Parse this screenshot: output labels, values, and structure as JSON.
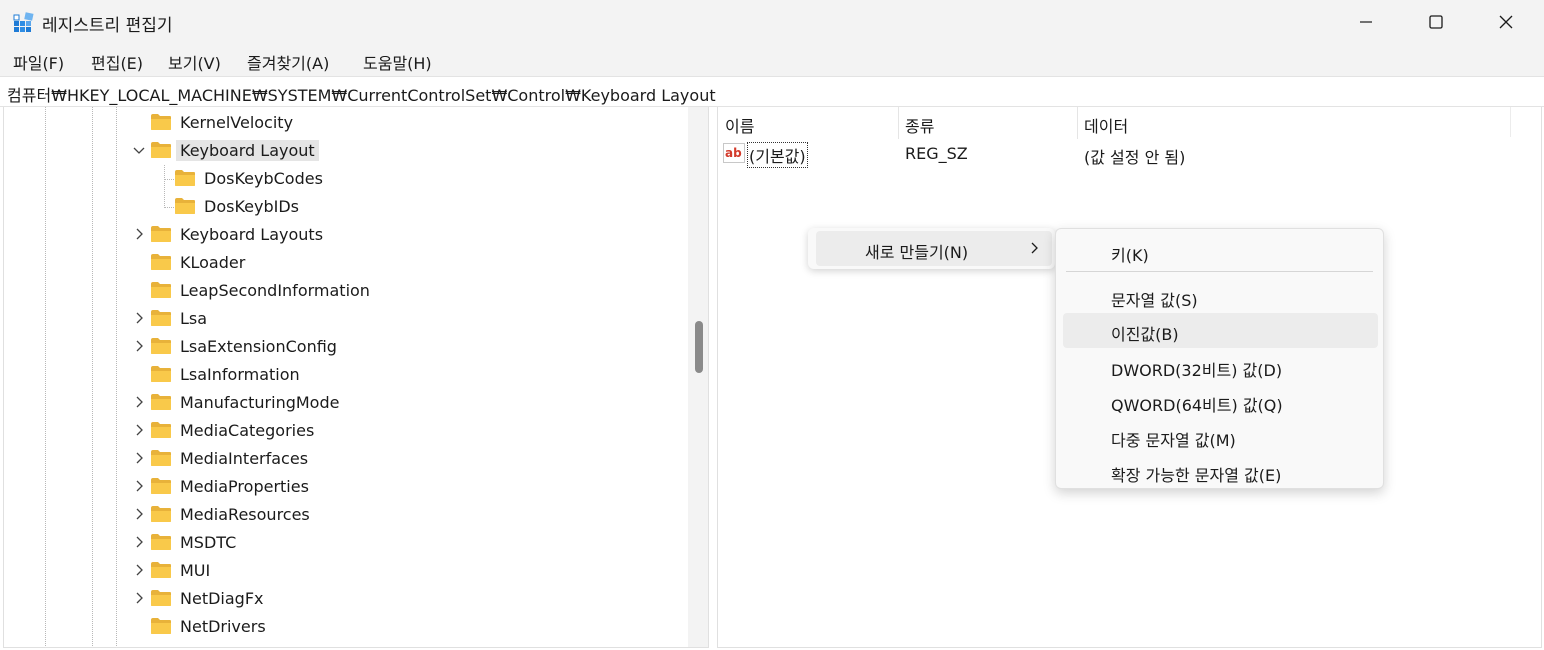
{
  "window": {
    "title": "레지스트리 편집기",
    "controls": [
      "minimize-icon",
      "maximize-icon",
      "close-icon"
    ]
  },
  "menubar": {
    "items": [
      {
        "label": "파일(F)"
      },
      {
        "label": "편집(E)"
      },
      {
        "label": "보기(V)"
      },
      {
        "label": "즐겨찾기(A)"
      },
      {
        "label": "도움말(H)"
      }
    ]
  },
  "address": {
    "path": "컴퓨터₩HKEY_LOCAL_MACHINE₩SYSTEM₩CurrentControlSet₩Control₩Keyboard Layout"
  },
  "tree": {
    "items": [
      {
        "label": "KernelVelocity",
        "expander": "none",
        "selected": false
      },
      {
        "label": "Keyboard Layout",
        "expander": "expanded",
        "selected": true
      },
      {
        "label": "DosKeybCodes",
        "expander": "none",
        "selected": false
      },
      {
        "label": "DosKeybIDs",
        "expander": "none",
        "selected": false
      },
      {
        "label": "Keyboard Layouts",
        "expander": "collapsed",
        "selected": false
      },
      {
        "label": "KLoader",
        "expander": "none",
        "selected": false
      },
      {
        "label": "LeapSecondInformation",
        "expander": "none",
        "selected": false
      },
      {
        "label": "Lsa",
        "expander": "collapsed",
        "selected": false
      },
      {
        "label": "LsaExtensionConfig",
        "expander": "collapsed",
        "selected": false
      },
      {
        "label": "LsaInformation",
        "expander": "none",
        "selected": false
      },
      {
        "label": "ManufacturingMode",
        "expander": "collapsed",
        "selected": false
      },
      {
        "label": "MediaCategories",
        "expander": "collapsed",
        "selected": false
      },
      {
        "label": "MediaInterfaces",
        "expander": "collapsed",
        "selected": false
      },
      {
        "label": "MediaProperties",
        "expander": "collapsed",
        "selected": false
      },
      {
        "label": "MediaResources",
        "expander": "collapsed",
        "selected": false
      },
      {
        "label": "MSDTC",
        "expander": "collapsed",
        "selected": false
      },
      {
        "label": "MUI",
        "expander": "collapsed",
        "selected": false
      },
      {
        "label": "NetDiagFx",
        "expander": "collapsed",
        "selected": false
      },
      {
        "label": "NetDrivers",
        "expander": "none",
        "selected": false
      }
    ]
  },
  "list": {
    "columns": [
      "이름",
      "종류",
      "데이터"
    ],
    "rows": [
      {
        "icon": "string-value-icon",
        "name": "(기본값)",
        "type": "REG_SZ",
        "data": "(값 설정 안 됨)"
      }
    ]
  },
  "context_menu": {
    "new_label": "새로 만들기(N)",
    "submenu": [
      {
        "label": "키(K)"
      },
      {
        "label": "문자열 값(S)"
      },
      {
        "label": "이진값(B)"
      },
      {
        "label": "DWORD(32비트) 값(D)"
      },
      {
        "label": "QWORD(64비트) 값(Q)"
      },
      {
        "label": "다중 문자열 값(M)"
      },
      {
        "label": "확장 가능한 문자열 값(E)"
      }
    ]
  },
  "colors": {
    "folder": "#f9c94a",
    "selection": "#e5e5e5",
    "chrome": "#f3f3f3"
  }
}
